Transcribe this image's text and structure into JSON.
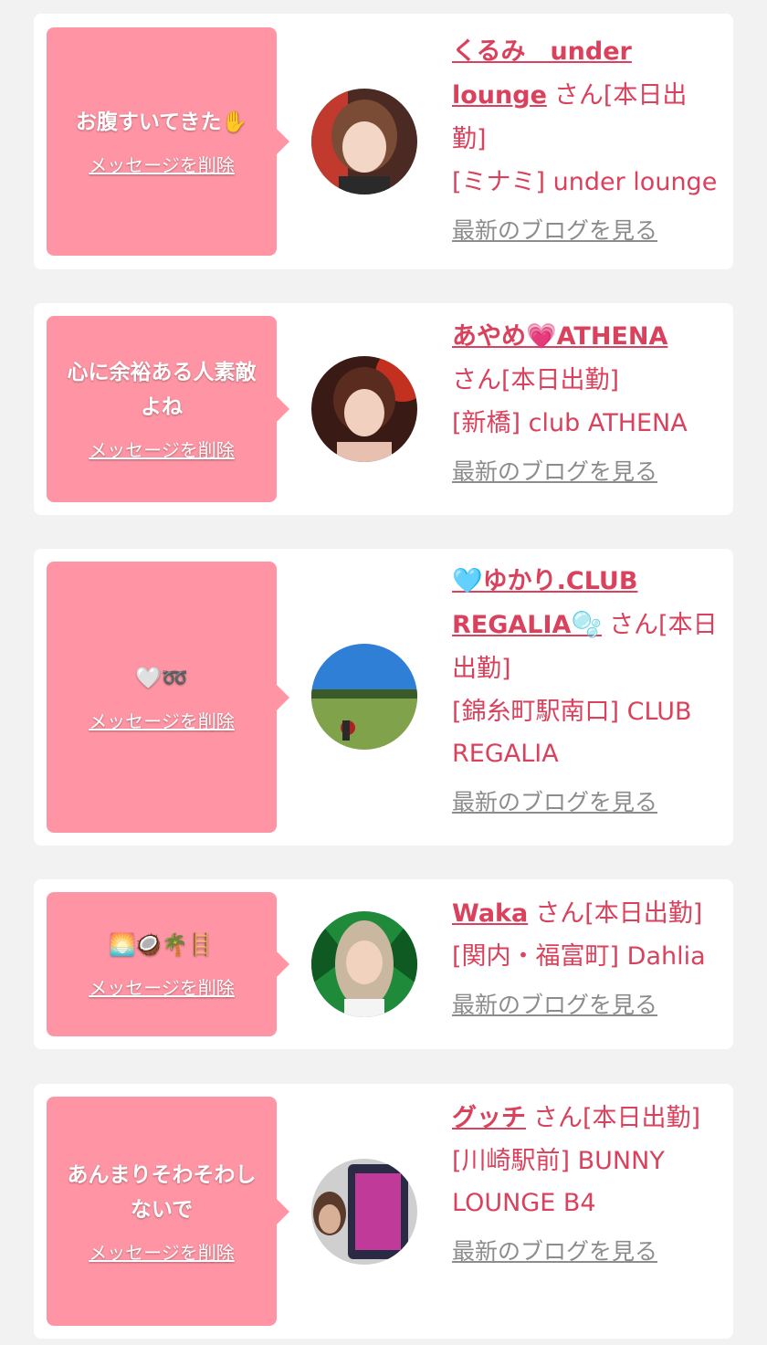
{
  "colors": {
    "page_bg": "#f2f2f2",
    "card_bg": "#ffffff",
    "bubble_bg": "#ff95a4",
    "accent_text": "#d9415c",
    "muted_text": "#8c8c8c"
  },
  "delete_label": "メッセージを削除",
  "blog_label": "最新のブログを見る",
  "messages": [
    {
      "message": "お腹すいてきた✋",
      "name": "くるみ　under lounge",
      "suffix": "さん[本日出勤]",
      "shop": "[ミナミ] under lounge"
    },
    {
      "message": "心に余裕ある人素敵よね",
      "name": "あやめ💗ATHENA",
      "suffix": "さん[本日出勤]",
      "shop": "[新橋] club ATHENA"
    },
    {
      "message": "🤍➿",
      "name": "🩵ゆかり.CLUB REGALIA🫧",
      "suffix": "さん[本日出勤]",
      "shop": "[錦糸町駅南口] CLUB REGALIA"
    },
    {
      "message": "🌅🥥🌴🪜",
      "name": "Waka",
      "suffix": "さん[本日出勤]",
      "shop": "[関内・福富町] Dahlia"
    },
    {
      "message": "あんまりそわそわしないで",
      "name": "グッチ",
      "suffix": "さん[本日出勤]",
      "shop": "[川崎駅前] BUNNY LOUNGE B4"
    }
  ]
}
